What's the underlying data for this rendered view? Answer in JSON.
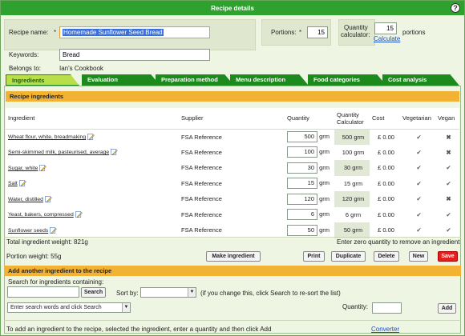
{
  "window": {
    "title": "Recipe details"
  },
  "form": {
    "recipe_name_label": "Recipe name:",
    "recipe_name_value": "Homemade Sunflower Seed Bread",
    "keywords_label": "Keywords:",
    "keywords_value": "Bread",
    "belongs_label": "Belongs to:",
    "belongs_value": "Ian's Cookbook",
    "portions_label": "Portions:",
    "portions_value": "15",
    "qcalc_label_line1": "Quantity",
    "qcalc_label_line2": "calculator:",
    "qcalc_value": "15",
    "qcalc_unit": "portions",
    "calculate_link": "Calculate",
    "required_mark": "*"
  },
  "tabs": [
    {
      "label": "Ingredients",
      "active": true
    },
    {
      "label": "Evaluation",
      "active": false
    },
    {
      "label": "Preparation method",
      "active": false
    },
    {
      "label": "Menu description",
      "active": false
    },
    {
      "label": "Food categories",
      "active": false
    },
    {
      "label": "Cost analysis",
      "active": false
    }
  ],
  "ingredients_section": {
    "header": "Recipe ingredients",
    "columns": {
      "ingredient": "Ingredient",
      "supplier": "Supplier",
      "quantity": "Quantity",
      "qcalc_line1": "Quantity",
      "qcalc_line2": "Calculator",
      "cost": "Cost",
      "vegetarian": "Vegetarian",
      "vegan": "Vegan"
    },
    "rows": [
      {
        "name": "Wheat flour, white, breadmaking",
        "supplier": "FSA Reference",
        "qty": "500",
        "unit": "grm",
        "calc": "500 grm",
        "cost": "£ 0.00",
        "veg": "check",
        "vegan": "cross"
      },
      {
        "name": "Semi-skimmed milk, pasteurised, average",
        "supplier": "FSA Reference",
        "qty": "100",
        "unit": "grm",
        "calc": "100 grm",
        "cost": "£ 0.00",
        "veg": "check",
        "vegan": "cross"
      },
      {
        "name": "Sugar, white",
        "supplier": "FSA Reference",
        "qty": "30",
        "unit": "grm",
        "calc": "30 grm",
        "cost": "£ 0.00",
        "veg": "check",
        "vegan": "check"
      },
      {
        "name": "Salt",
        "supplier": "FSA Reference",
        "qty": "15",
        "unit": "grm",
        "calc": "15 grm",
        "cost": "£ 0.00",
        "veg": "check",
        "vegan": "check"
      },
      {
        "name": "Water, distilled",
        "supplier": "FSA Reference",
        "qty": "120",
        "unit": "grm",
        "calc": "120 grm",
        "cost": "£ 0.00",
        "veg": "check",
        "vegan": "cross"
      },
      {
        "name": "Yeast, bakers, compressed",
        "supplier": "FSA Reference",
        "qty": "6",
        "unit": "grm",
        "calc": "6 grm",
        "cost": "£ 0.00",
        "veg": "check",
        "vegan": "check"
      },
      {
        "name": "Sunflower seeds",
        "supplier": "FSA Reference",
        "qty": "50",
        "unit": "grm",
        "calc": "50 grm",
        "cost": "£ 0.00",
        "veg": "check",
        "vegan": "check"
      }
    ],
    "total_weight": "Total ingredient weight: 821g",
    "zero_hint": "Enter zero quantity to remove an ingredient",
    "portion_weight": "Portion weight: 55g"
  },
  "buttons": {
    "make_ingredient": "Make ingredient",
    "print": "Print",
    "duplicate": "Duplicate",
    "delete": "Delete",
    "new": "New",
    "save": "Save",
    "search": "Search",
    "add": "Add"
  },
  "add_section": {
    "header": "Add another ingredient to the recipe",
    "search_label": "Search for ingredients containing:",
    "sort_label": "Sort by:",
    "sort_hint": "(if you change this, click Search to re-sort the list)",
    "results_placeholder": "Enter search words and click Search",
    "quantity_label": "Quantity:",
    "instructions": "To add an ingredient to the recipe, selected the ingredient, enter a quantity and then click Add",
    "converter_link": "Converter"
  },
  "icons": {
    "help": "help-icon",
    "edit": "pencil-edit-icon",
    "check": "check-icon",
    "cross": "cross-icon"
  },
  "colors": {
    "titlebar": "#2fa12f",
    "tab": "#1d8a1d",
    "tab_active": "#b8df4a",
    "section_header": "#f2b233",
    "save": "#e01f1f"
  }
}
